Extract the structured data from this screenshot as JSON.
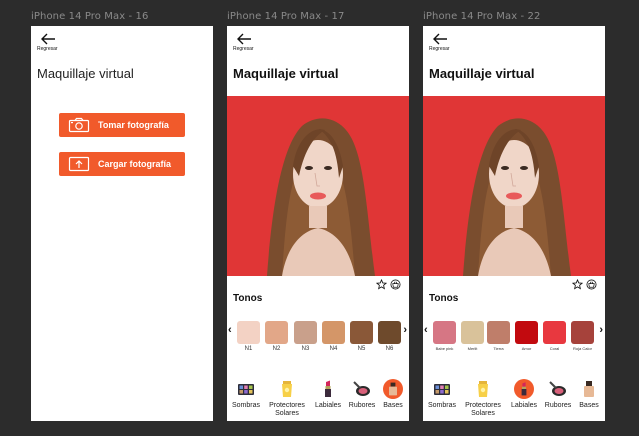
{
  "frames": [
    {
      "label": "iPhone 14 Pro Max - 16",
      "back_label": "Regresar",
      "title": "Maquillaje virtual",
      "buttons": [
        {
          "label": "Tomar fotografía",
          "icon": "camera-icon"
        },
        {
          "label": "Cargar fotografía",
          "icon": "upload-icon"
        }
      ]
    },
    {
      "label": "iPhone 14 Pro Max - 17",
      "back_label": "Regresar",
      "title": "Maquillaje virtual",
      "section_title": "Tonos",
      "swatches": [
        {
          "label": "N1",
          "color": "#f3d2c4"
        },
        {
          "label": "N2",
          "color": "#e2a788"
        },
        {
          "label": "N3",
          "color": "#c9a08b"
        },
        {
          "label": "N4",
          "color": "#d49668"
        },
        {
          "label": "N5",
          "color": "#8a5838"
        },
        {
          "label": "N6",
          "color": "#6e4a2c"
        }
      ],
      "nav": [
        {
          "label": "Sombras",
          "icon": "eyeshadow-palette-icon"
        },
        {
          "label": "Protectores Solares",
          "icon": "sunscreen-icon"
        },
        {
          "label": "Labiales",
          "icon": "lipstick-icon"
        },
        {
          "label": "Rubores",
          "icon": "blush-icon"
        },
        {
          "label": "Bases",
          "icon": "foundation-icon",
          "active": true
        }
      ]
    },
    {
      "label": "iPhone 14 Pro Max - 22",
      "back_label": "Regresar",
      "title": "Maquillaje virtual",
      "section_title": "Tonos",
      "swatches": [
        {
          "label": "Babe pink",
          "color": "#d67684"
        },
        {
          "label": "Merlit",
          "color": "#d9c29a"
        },
        {
          "label": "Tierra",
          "color": "#bf7e6a"
        },
        {
          "label": "Amor",
          "color": "#c20a0f"
        },
        {
          "label": "Coral",
          "color": "#e8383f"
        },
        {
          "label": "Roja Calor",
          "color": "#a6423b"
        }
      ],
      "nav": [
        {
          "label": "Sombras",
          "icon": "eyeshadow-palette-icon"
        },
        {
          "label": "Protectores Solares",
          "icon": "sunscreen-icon"
        },
        {
          "label": "Labiales",
          "icon": "lipstick-icon",
          "active": true
        },
        {
          "label": "Rubores",
          "icon": "blush-icon"
        },
        {
          "label": "Bases",
          "icon": "foundation-icon"
        }
      ]
    }
  ],
  "colors": {
    "accent": "#f15a2b",
    "photo_bg": "#e03636",
    "canvas": "#2c2c2c"
  }
}
